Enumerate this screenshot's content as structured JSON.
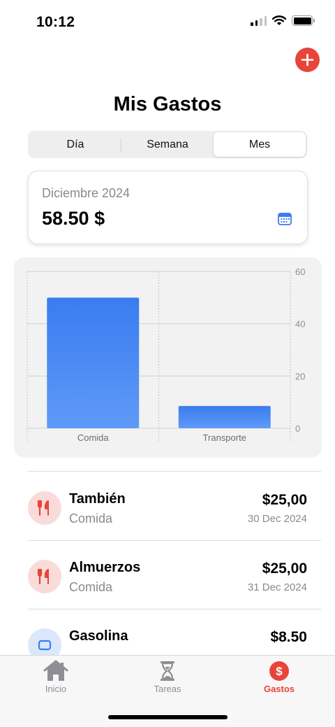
{
  "status_bar": {
    "time": "10:12"
  },
  "header": {
    "title": "Mis Gastos",
    "add_icon": "plus-icon"
  },
  "segments": [
    {
      "label": "Día",
      "active": false
    },
    {
      "label": "Semana",
      "active": false
    },
    {
      "label": "Mes",
      "active": true
    }
  ],
  "summary": {
    "period": "Diciembre 2024",
    "total": "58.50 $",
    "icon": "calendar-icon"
  },
  "chart_data": {
    "type": "bar",
    "categories": [
      "Comida",
      "Transporte"
    ],
    "values": [
      50,
      8.5
    ],
    "title": "",
    "xlabel": "",
    "ylabel": "",
    "ylim": [
      0,
      60
    ],
    "yticks": [
      "0",
      "20",
      "40",
      "60"
    ],
    "bar_color": "#4b8ef5",
    "y_axis_side": "right",
    "grid": true
  },
  "expenses": [
    {
      "title": "También",
      "category": "Comida",
      "amount": "$25,00",
      "date": "30 Dec 2024",
      "icon": "fork-knife-icon",
      "icon_bg": "#f9dcda",
      "icon_color": "#e8443a"
    },
    {
      "title": "Almuerzos",
      "category": "Comida",
      "amount": "$25,00",
      "date": "31 Dec 2024",
      "icon": "fork-knife-icon",
      "icon_bg": "#f9dcda",
      "icon_color": "#e8443a"
    },
    {
      "title": "Gasolina",
      "category": "",
      "amount": "$8.50",
      "date": "",
      "icon": "car-icon",
      "icon_bg": "#dbe8fb",
      "icon_color": "#3b7bf2"
    }
  ],
  "tabs": [
    {
      "label": "Inicio",
      "icon": "house-icon",
      "active": false
    },
    {
      "label": "Tareas",
      "icon": "hourglass-icon",
      "active": false
    },
    {
      "label": "Gastos",
      "icon": "dollar-circle-icon",
      "active": true
    }
  ],
  "colors": {
    "accent": "#e8443a",
    "chart_blue": "#4b8ef5",
    "secondary_text": "#8a8a8e"
  }
}
